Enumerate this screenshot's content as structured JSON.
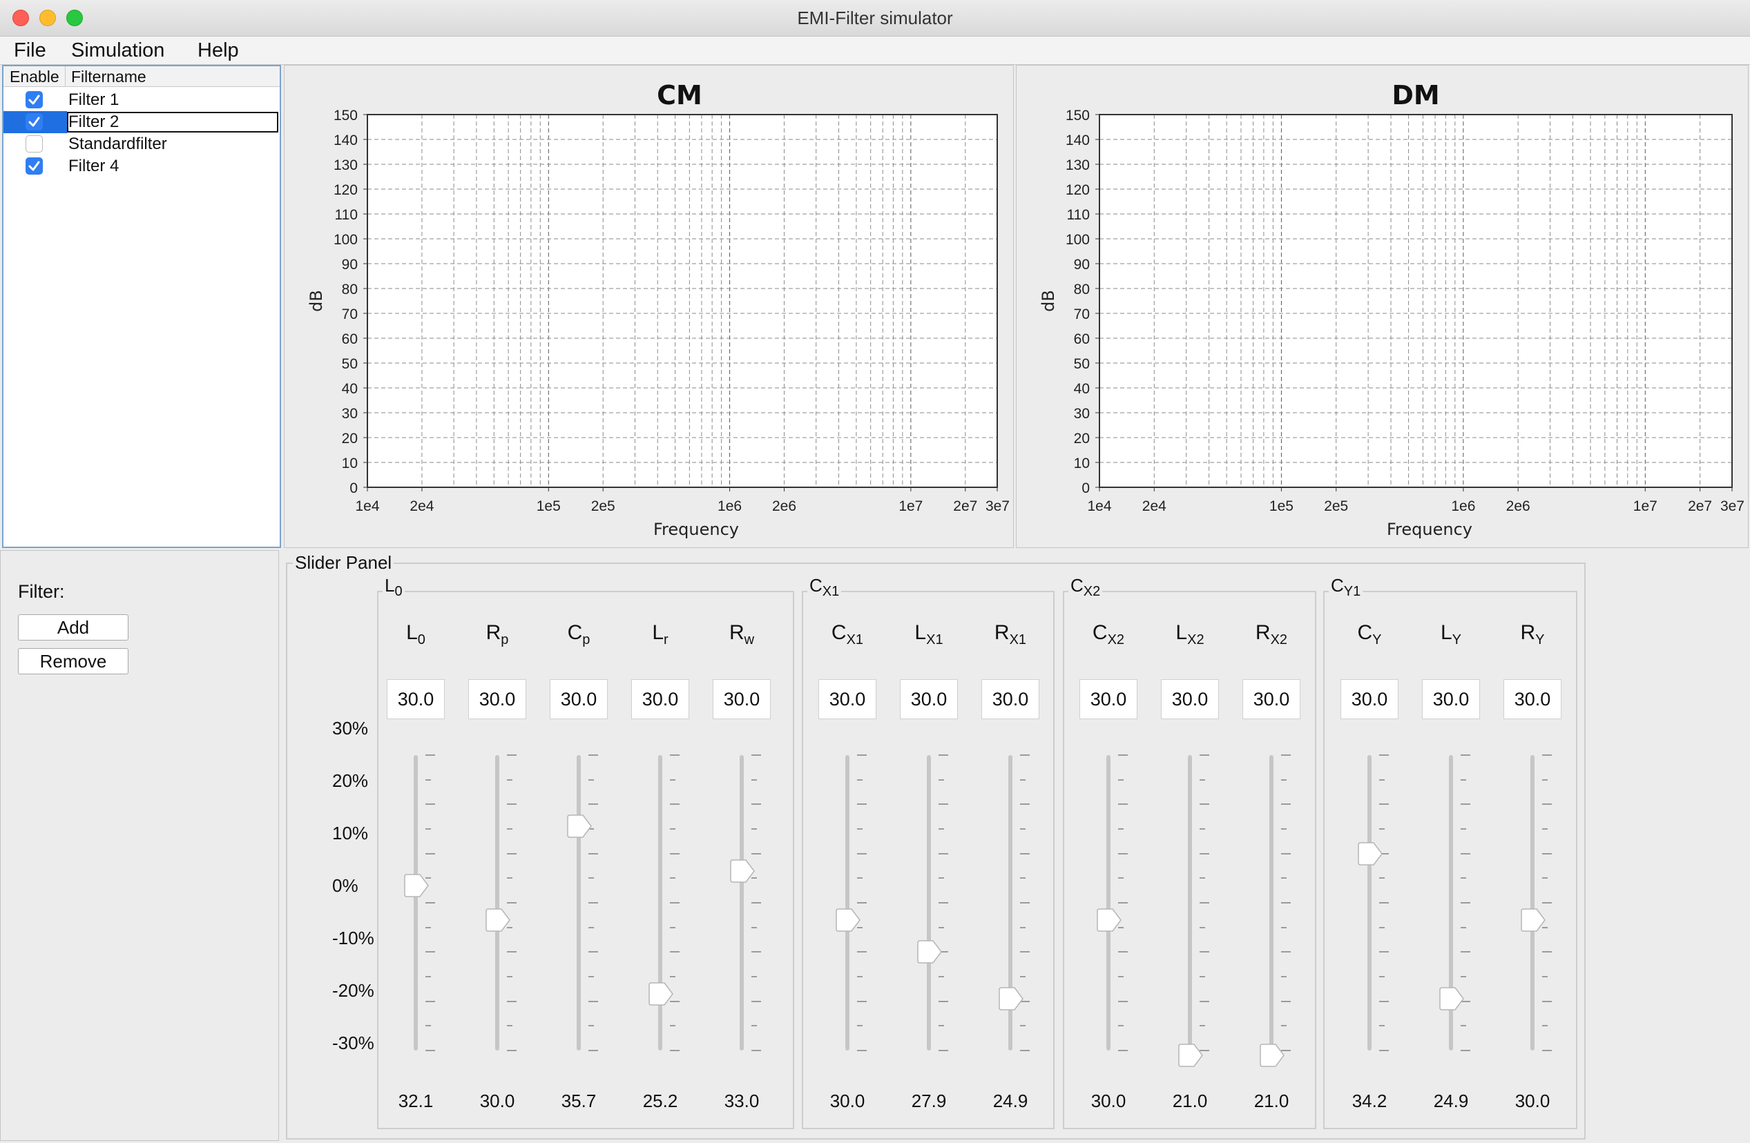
{
  "window": {
    "title": "EMI-Filter simulator"
  },
  "menu": [
    "File",
    "Simulation",
    "Help"
  ],
  "filter_table": {
    "headers": {
      "enable": "Enable",
      "name": "Filtername"
    },
    "rows": [
      {
        "enabled": true,
        "name": "Filter 1"
      },
      {
        "enabled": true,
        "name": "Filter 2",
        "selected": true
      },
      {
        "enabled": false,
        "name": "Standardfilter"
      },
      {
        "enabled": true,
        "name": "Filter 4"
      }
    ]
  },
  "filter_controls": {
    "label": "Filter:",
    "add": "Add",
    "remove": "Remove"
  },
  "chart_data": [
    {
      "type": "line",
      "title": "CM",
      "xlabel": "Frequency",
      "ylabel": "dB",
      "xscale": "log",
      "xlim": [
        10000,
        30000000
      ],
      "ylim": [
        0,
        150
      ],
      "yticks": [
        "0",
        "10",
        "20",
        "30",
        "40",
        "50",
        "60",
        "70",
        "80",
        "90",
        "100",
        "110",
        "120",
        "130",
        "140",
        "150"
      ],
      "xticks": [
        "1e4",
        "2e4",
        "1e5",
        "2e5",
        "1e6",
        "2e6",
        "1e7",
        "2e7",
        "3e7"
      ],
      "grid": true,
      "series": []
    },
    {
      "type": "line",
      "title": "DM",
      "xlabel": "Frequency",
      "ylabel": "dB",
      "xscale": "log",
      "xlim": [
        10000,
        30000000
      ],
      "ylim": [
        0,
        150
      ],
      "yticks": [
        "0",
        "10",
        "20",
        "30",
        "40",
        "50",
        "60",
        "70",
        "80",
        "90",
        "100",
        "110",
        "120",
        "130",
        "140",
        "150"
      ],
      "xticks": [
        "1e4",
        "2e4",
        "1e5",
        "2e5",
        "1e6",
        "2e6",
        "1e7",
        "2e7",
        "3e7"
      ],
      "grid": true,
      "series": []
    }
  ],
  "slider_panel": {
    "title": "Slider Panel",
    "scale": [
      "30%",
      "20%",
      "10%",
      "0%",
      "-10%",
      "-20%",
      "-30%"
    ],
    "groups": [
      {
        "title": "L",
        "title_sub": "0",
        "sliders": [
          {
            "sym": "L",
            "sub": "0",
            "field": "30.0",
            "percent": 3.5,
            "value": "32.1"
          },
          {
            "sym": "R",
            "sub": "p",
            "field": "30.0",
            "percent": -3.5,
            "value": "30.0"
          },
          {
            "sym": "C",
            "sub": "p",
            "field": "30.0",
            "percent": 15.5,
            "value": "35.7"
          },
          {
            "sym": "L",
            "sub": "r",
            "field": "30.0",
            "percent": -18.5,
            "value": "25.2"
          },
          {
            "sym": "R",
            "sub": "w",
            "field": "30.0",
            "percent": 6.5,
            "value": "33.0"
          }
        ]
      },
      {
        "title": "C",
        "title_sub": "X1",
        "sliders": [
          {
            "sym": "C",
            "sub": "X1",
            "field": "30.0",
            "percent": -3.5,
            "value": "30.0"
          },
          {
            "sym": "L",
            "sub": "X1",
            "field": "30.0",
            "percent": -10,
            "value": "27.9"
          },
          {
            "sym": "R",
            "sub": "X1",
            "field": "30.0",
            "percent": -19.5,
            "value": "24.9"
          }
        ]
      },
      {
        "title": "C",
        "title_sub": "X2",
        "sliders": [
          {
            "sym": "C",
            "sub": "X2",
            "field": "30.0",
            "percent": -3.5,
            "value": "30.0"
          },
          {
            "sym": "L",
            "sub": "X2",
            "field": "30.0",
            "percent": -31,
            "value": "21.0"
          },
          {
            "sym": "R",
            "sub": "X2",
            "field": "30.0",
            "percent": -31,
            "value": "21.0"
          }
        ]
      },
      {
        "title": "C",
        "title_sub": "Y1",
        "sliders": [
          {
            "sym": "C",
            "sub": "Y",
            "field": "30.0",
            "percent": 10,
            "value": "34.2"
          },
          {
            "sym": "L",
            "sub": "Y",
            "field": "30.0",
            "percent": -19.5,
            "value": "24.9"
          },
          {
            "sym": "R",
            "sub": "Y",
            "field": "30.0",
            "percent": -3.5,
            "value": "30.0"
          }
        ]
      }
    ]
  },
  "colors": {
    "accent": "#2f7ef2",
    "selection": "#1f6fe0",
    "close": "#fe5f57",
    "minimize": "#febc2e",
    "zoom": "#28c840"
  }
}
